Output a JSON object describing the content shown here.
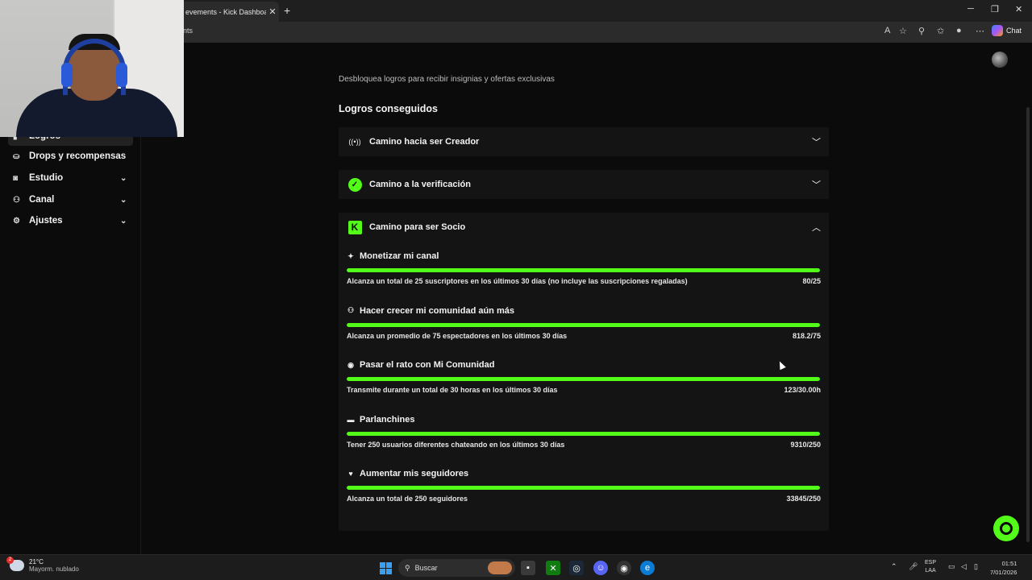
{
  "browser": {
    "tab_title": "evements - Kick Dashboard",
    "tab_close": "✕",
    "new_tab": "+",
    "address": "ents",
    "chat_label": "Chat",
    "window_controls": [
      "─",
      "❐",
      "✕"
    ]
  },
  "sidebar": {
    "items": [
      {
        "label": "Logros",
        "icon": "trophy-icon",
        "glyph": "▮",
        "chevron": false,
        "active": true
      },
      {
        "label": "Drops y recompensas",
        "icon": "gift-icon",
        "glyph": "⛀",
        "chevron": false,
        "active": false
      },
      {
        "label": "Estudio",
        "icon": "studio-icon",
        "glyph": "◙",
        "chevron": true,
        "active": false
      },
      {
        "label": "Canal",
        "icon": "channel-icon",
        "glyph": "⚇",
        "chevron": true,
        "active": false
      },
      {
        "label": "Ajustes",
        "icon": "gear-icon",
        "glyph": "⚙",
        "chevron": true,
        "active": false
      }
    ]
  },
  "main": {
    "subtitle": "Desbloquea logros para recibir insignias y ofertas exclusivas",
    "section_title": "Logros conseguidos",
    "accordions": [
      {
        "title": "Camino hacia ser Creador",
        "icon": "broadcast-icon",
        "glyph": "((•))",
        "expanded": false
      },
      {
        "title": "Camino a la verificación",
        "icon": "verified-icon",
        "glyph": "✓",
        "expanded": false
      },
      {
        "title": "Camino para ser Socio",
        "icon": "kick-logo-icon",
        "glyph": "K",
        "expanded": true
      }
    ],
    "goals": [
      {
        "title": "Monetizar mi canal",
        "icon": "sparkle-icon",
        "glyph": "✦",
        "desc": "Alcanza un total de 25 suscriptores en los últimos 30 días (no incluye las suscripciones regaladas)",
        "value": "80/25",
        "progress": 1.0
      },
      {
        "title": "Hacer crecer mi comunidad aún más",
        "icon": "users-icon",
        "glyph": "⚇",
        "desc": "Alcanza un promedio de 75 espectadores en los últimos 30 días",
        "value": "818.2/75",
        "progress": 1.0
      },
      {
        "title": "Pasar el rato con Mi Comunidad",
        "icon": "broadcast-icon",
        "glyph": "◉",
        "desc": "Transmite durante un total de 30 horas en los últimos 30 días",
        "value": "123/30.00h",
        "progress": 1.0
      },
      {
        "title": "Parlanchines",
        "icon": "chat-bubble-icon",
        "glyph": "▬",
        "desc": "Tener 250 usuarios diferentes chateando en los últimos 30 días",
        "value": "9310/250",
        "progress": 1.0
      },
      {
        "title": "Aumentar mis seguidores",
        "icon": "heart-icon",
        "glyph": "♥",
        "desc": "Alcanza un total de 250 seguidores",
        "value": "33845/250",
        "progress": 1.0
      }
    ]
  },
  "colors": {
    "accent": "#53fc18",
    "background": "#0b0b0c",
    "card": "#141415"
  },
  "taskbar": {
    "weather_temp": "21°C",
    "weather_desc": "Mayorm. nublado",
    "weather_badge": "2",
    "search_placeholder": "Buscar",
    "lang_top": "ESP",
    "lang_bottom": "LAA",
    "time": "01:51",
    "date": "7/01/2026"
  }
}
